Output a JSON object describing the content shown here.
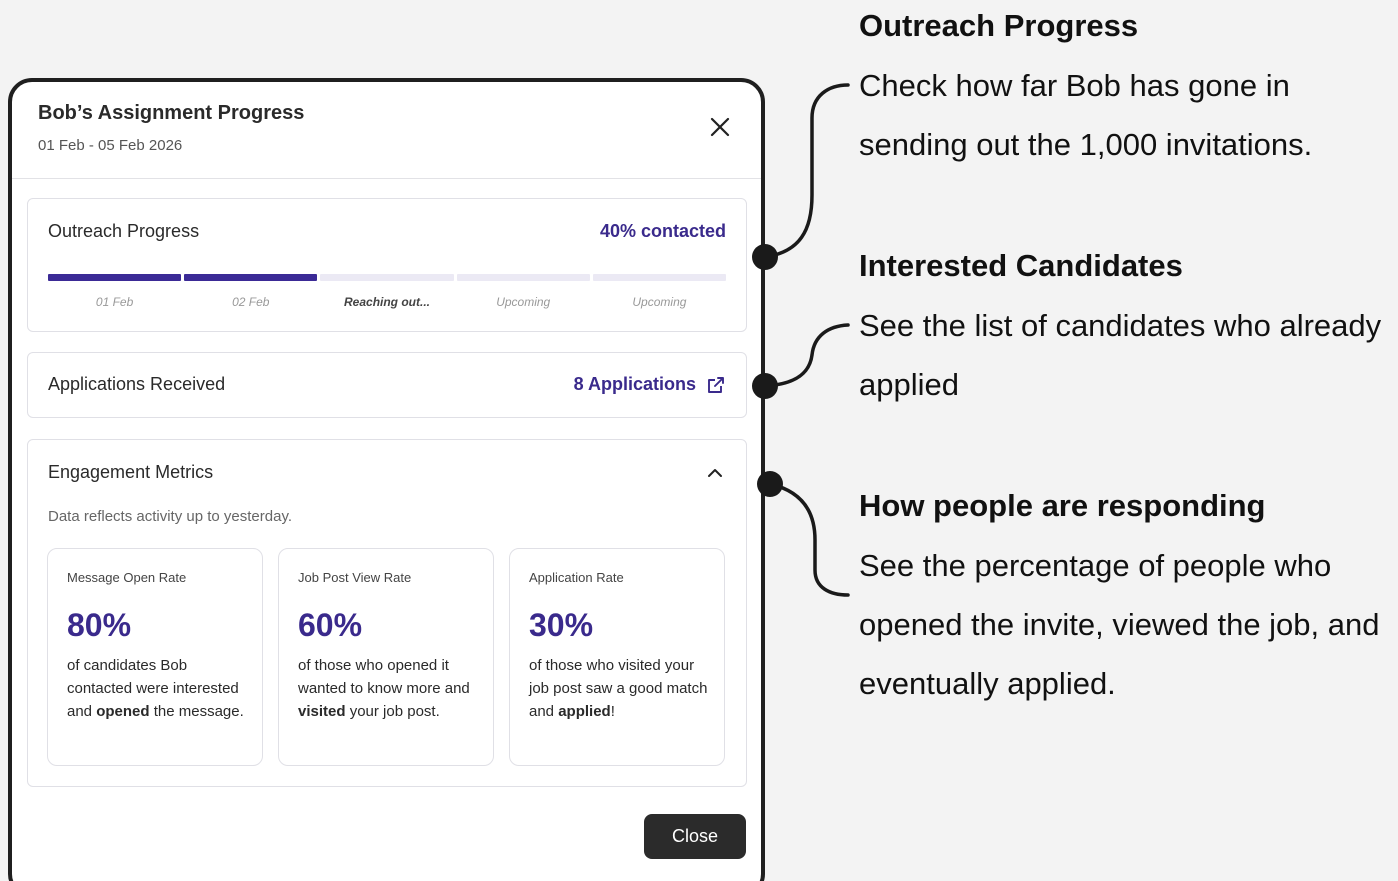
{
  "modal": {
    "title": "Bob’s Assignment Progress",
    "subtitle": "01 Feb - 05 Feb 2026",
    "close_icon": "close-icon",
    "close_button_label": "Close"
  },
  "outreach": {
    "title": "Outreach Progress",
    "status": "40% contacted",
    "progress_fraction": 0.4,
    "steps": [
      {
        "label": "01 Feb",
        "state": "done"
      },
      {
        "label": "02 Feb",
        "state": "done"
      },
      {
        "label": "Reaching out...",
        "state": "active"
      },
      {
        "label": "Upcoming",
        "state": "upcoming"
      },
      {
        "label": "Upcoming",
        "state": "upcoming"
      }
    ]
  },
  "applications": {
    "title": "Applications Received",
    "link_label": "8 Applications",
    "icon": "external-link-icon"
  },
  "engagement": {
    "title": "Engagement Metrics",
    "icon": "chevron-up-icon",
    "note": "Data reflects activity up to yesterday.",
    "metrics": [
      {
        "label": "Message Open Rate",
        "value": "80%",
        "desc_before": "of candidates Bob contacted were interested and ",
        "desc_bold": "opened",
        "desc_after": " the message."
      },
      {
        "label": "Job Post View Rate",
        "value": "60%",
        "desc_before": "of those who opened it wanted to know more and ",
        "desc_bold": "visited",
        "desc_after": " your job post."
      },
      {
        "label": "Application Rate",
        "value": "30%",
        "desc_before": "of those who visited your job post saw a good match and ",
        "desc_bold": "applied",
        "desc_after": "!"
      }
    ]
  },
  "annotations": [
    {
      "title": "Outreach Progress",
      "body": "Check how far Bob has gone in sending out the 1,000 invitations."
    },
    {
      "title": "Interested Candidates",
      "body": "See the list of candidates who already applied"
    },
    {
      "title": "How people are responding",
      "body": "See the percentage of people who opened the invite, viewed the job, and eventually applied."
    }
  ],
  "colors": {
    "accent": "#3a2a8c",
    "progress_done": "#3b2a96",
    "progress_pending": "#ebe9f4",
    "button_bg": "#2b2b2b",
    "page_bg": "#f3f3f3"
  }
}
